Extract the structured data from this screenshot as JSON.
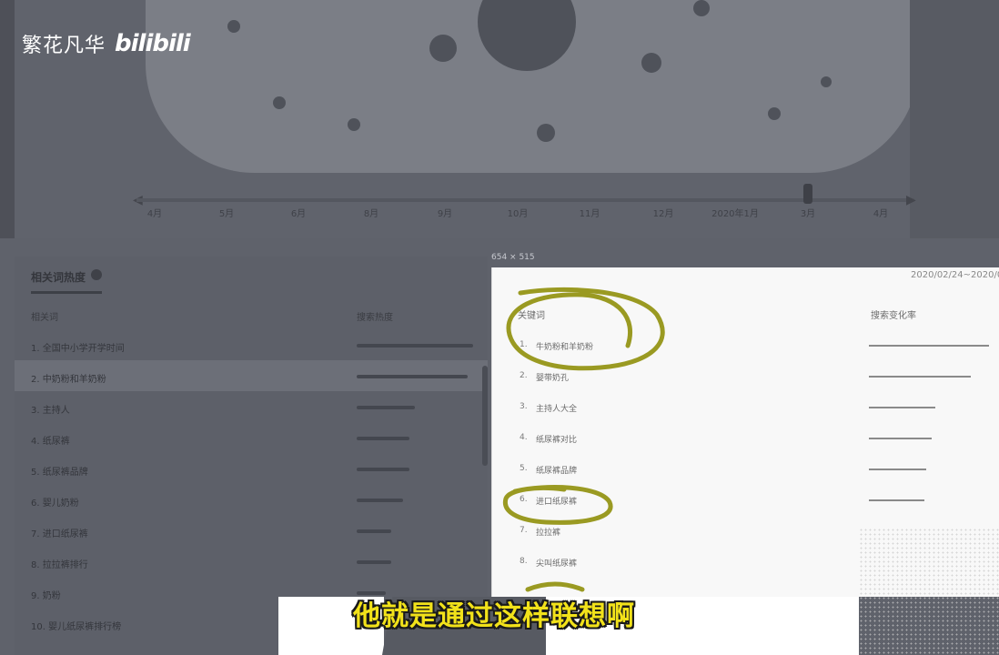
{
  "logo": {
    "text_cn": "繁花凡华",
    "brand": "bilibili"
  },
  "timeline": {
    "labels": [
      "4月",
      "5月",
      "6月",
      "8月",
      "9月",
      "10月",
      "11月",
      "12月",
      "2020年1月",
      "3月",
      "4月"
    ]
  },
  "bg_panel": {
    "title": "相关词热度",
    "col_keyword": "相关词",
    "col_heat": "搜索热度",
    "rows": [
      {
        "label": "1. 全国中小学开学时间",
        "bar": 1.0
      },
      {
        "label": "2. 中奶粉和羊奶粉",
        "bar": 0.95
      },
      {
        "label": "3. 主持人",
        "bar": 0.5
      },
      {
        "label": "4. 纸尿裤",
        "bar": 0.45
      },
      {
        "label": "5. 纸尿裤品牌",
        "bar": 0.45
      },
      {
        "label": "6. 婴儿奶粉",
        "bar": 0.4
      },
      {
        "label": "7. 进口纸尿裤",
        "bar": 0.3
      },
      {
        "label": "8. 拉拉裤排行",
        "bar": 0.3
      },
      {
        "label": "9. 奶粉",
        "bar": 0.25
      },
      {
        "label": "10. 婴儿纸尿裤排行榜",
        "bar": 0.2
      }
    ]
  },
  "snip": {
    "size_label": "654 × 515",
    "date": "2020/02/24~2020/0",
    "col_keyword": "关键词",
    "col_rate": "搜索变化率",
    "rows": [
      {
        "num": "1.",
        "keyword": "牛奶粉和羊奶粉",
        "bar": 1.0
      },
      {
        "num": "2.",
        "keyword": "婴带奶孔",
        "bar": 0.85
      },
      {
        "num": "3.",
        "keyword": "主持人大全",
        "bar": 0.55
      },
      {
        "num": "4.",
        "keyword": "纸尿裤对比",
        "bar": 0.52
      },
      {
        "num": "5.",
        "keyword": "纸尿裤品牌",
        "bar": 0.48
      },
      {
        "num": "6.",
        "keyword": "进口纸尿裤",
        "bar": 0.46
      },
      {
        "num": "7.",
        "keyword": "拉拉裤",
        "bar": 0
      },
      {
        "num": "8.",
        "keyword": "尖叫纸尿裤",
        "bar": 0
      }
    ]
  },
  "subtitle": "他就是通过这样联想啊"
}
